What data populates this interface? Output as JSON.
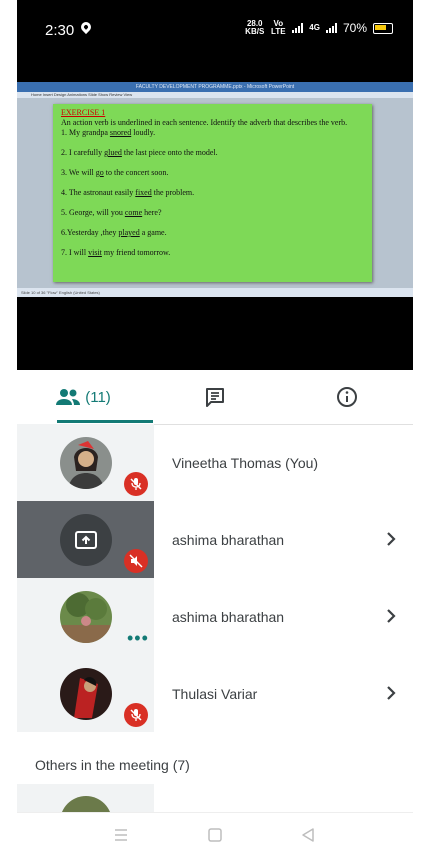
{
  "status_bar": {
    "time": "2:30",
    "speed_value": "28.0",
    "speed_unit": "KB/S",
    "volte": "Vo LTE",
    "network": "4G",
    "battery_percent": "70%"
  },
  "presentation": {
    "window_title": "FACULTY DEVELOPMENT PROGRAMME.pptx - Microsoft PowerPoint",
    "menu": "Home    Insert    Design    Animations    Slide Show    Review    View",
    "status": "Slide 10 of 36    \"Flow\"    English (United States)",
    "slide": {
      "heading": "EXERCISE 1",
      "intro": "An action verb is underlined in each sentence. Identify the adverb that describes the verb.",
      "s1_pre": "1. My grandpa ",
      "s1_verb": "snored",
      "s1_post": " loudly.",
      "s2_pre": "2.  I carefully ",
      "s2_verb": "glued",
      "s2_post": " the last piece onto the model.",
      "s3_pre": "3. We will ",
      "s3_verb": "go",
      "s3_post": " to the concert soon.",
      "s4_pre": "4. The astronaut easily ",
      "s4_verb": "fixed",
      "s4_post": " the problem.",
      "s5_pre": "5. George, will you ",
      "s5_verb": "come",
      "s5_post": " here?",
      "s6_pre": "6.Yesterday ,they ",
      "s6_verb": "played",
      "s6_post": " a game.",
      "s7_pre": "7. I will ",
      "s7_verb": "visit",
      "s7_post": " my friend tomorrow."
    }
  },
  "tabs": {
    "people_count": "(11)",
    "people_icon": "people-icon",
    "chat_icon": "chat-icon",
    "info_icon": "info-icon"
  },
  "participants": [
    {
      "name": "Vineetha Thomas (You)",
      "muted": true
    },
    {
      "name": "ashima bharathan",
      "muted": true,
      "presenting": true
    },
    {
      "name": "ashima bharathan",
      "speaking": true
    },
    {
      "name": "Thulasi Variar",
      "muted": true
    }
  ],
  "others_heading": "Others in the meeting (7)",
  "colors": {
    "accent": "#137a75",
    "mute": "#d93025",
    "slide_bg": "#7ed957"
  }
}
